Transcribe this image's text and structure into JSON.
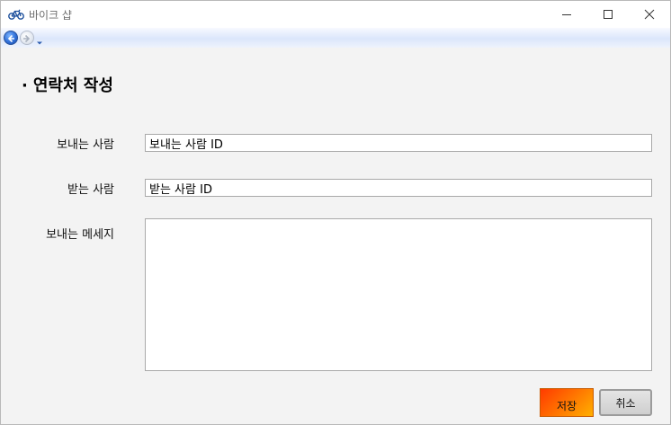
{
  "window": {
    "title": "바이크 샵",
    "app_icon": "bicycle-icon",
    "controls": [
      "minimize-icon",
      "maximize-icon",
      "close-icon"
    ]
  },
  "nav": {
    "back_icon": "back-arrow-icon",
    "forward_icon": "forward-arrow-icon",
    "dropdown_icon": "chevron-down-icon"
  },
  "page": {
    "heading_bullet": "·",
    "heading": "연락처 작성"
  },
  "form": {
    "sender_label": "보내는 사람",
    "sender_value": "보내는 사람 ID",
    "receiver_label": "받는 사람",
    "receiver_value": "받는 사람 ID",
    "message_label": "보내는 메세지",
    "message_value": ""
  },
  "buttons": {
    "save_label": "저장",
    "cancel_label": "취소"
  },
  "colors": {
    "save_gradient_start": "#ff3b00",
    "save_gradient_end": "#ffb000",
    "nav_back": "#2f6fd8",
    "background": "#f3f3f3"
  }
}
